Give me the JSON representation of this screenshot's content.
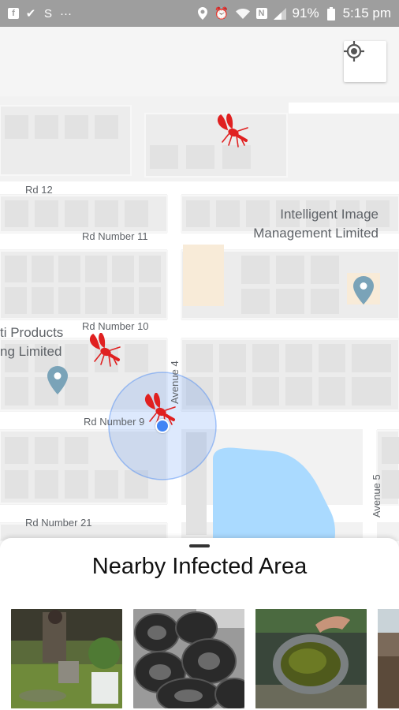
{
  "status_bar": {
    "left_icons": [
      "facebook-icon",
      "checkmark-icon",
      "shazam-icon",
      "more-dots-icon"
    ],
    "right_icons": [
      "location-icon",
      "alarm-icon",
      "wifi-icon",
      "nfc-icon",
      "signal-icon"
    ],
    "battery": "91%",
    "time": "5:15 pm"
  },
  "map": {
    "roads": {
      "rd12": "Rd 12",
      "rd11": "Rd Number 11",
      "rd10": "Rd Number 10",
      "rd9": "Rd Number 9",
      "rd21": "Rd Number 21",
      "avenue4": "Avenue 4",
      "avenue5": "Avenue 5"
    },
    "places": {
      "intelligent_line1": "Intelligent Image",
      "intelligent_line2": "Management Limited",
      "products_line1": "ti Products",
      "products_line2": "ng Limited"
    },
    "locate_button_icon": "my-location-icon",
    "marker_icon": "mosquito-icon",
    "accent_color": "#4285f4",
    "marker_color": "#e02020"
  },
  "sheet": {
    "title": "Nearby Infected Area",
    "thumbnails": [
      {
        "name": "thumbnail-person-pouring-water"
      },
      {
        "name": "thumbnail-tire-pile"
      },
      {
        "name": "thumbnail-bucket-green-water"
      },
      {
        "name": "thumbnail-partial"
      }
    ]
  }
}
